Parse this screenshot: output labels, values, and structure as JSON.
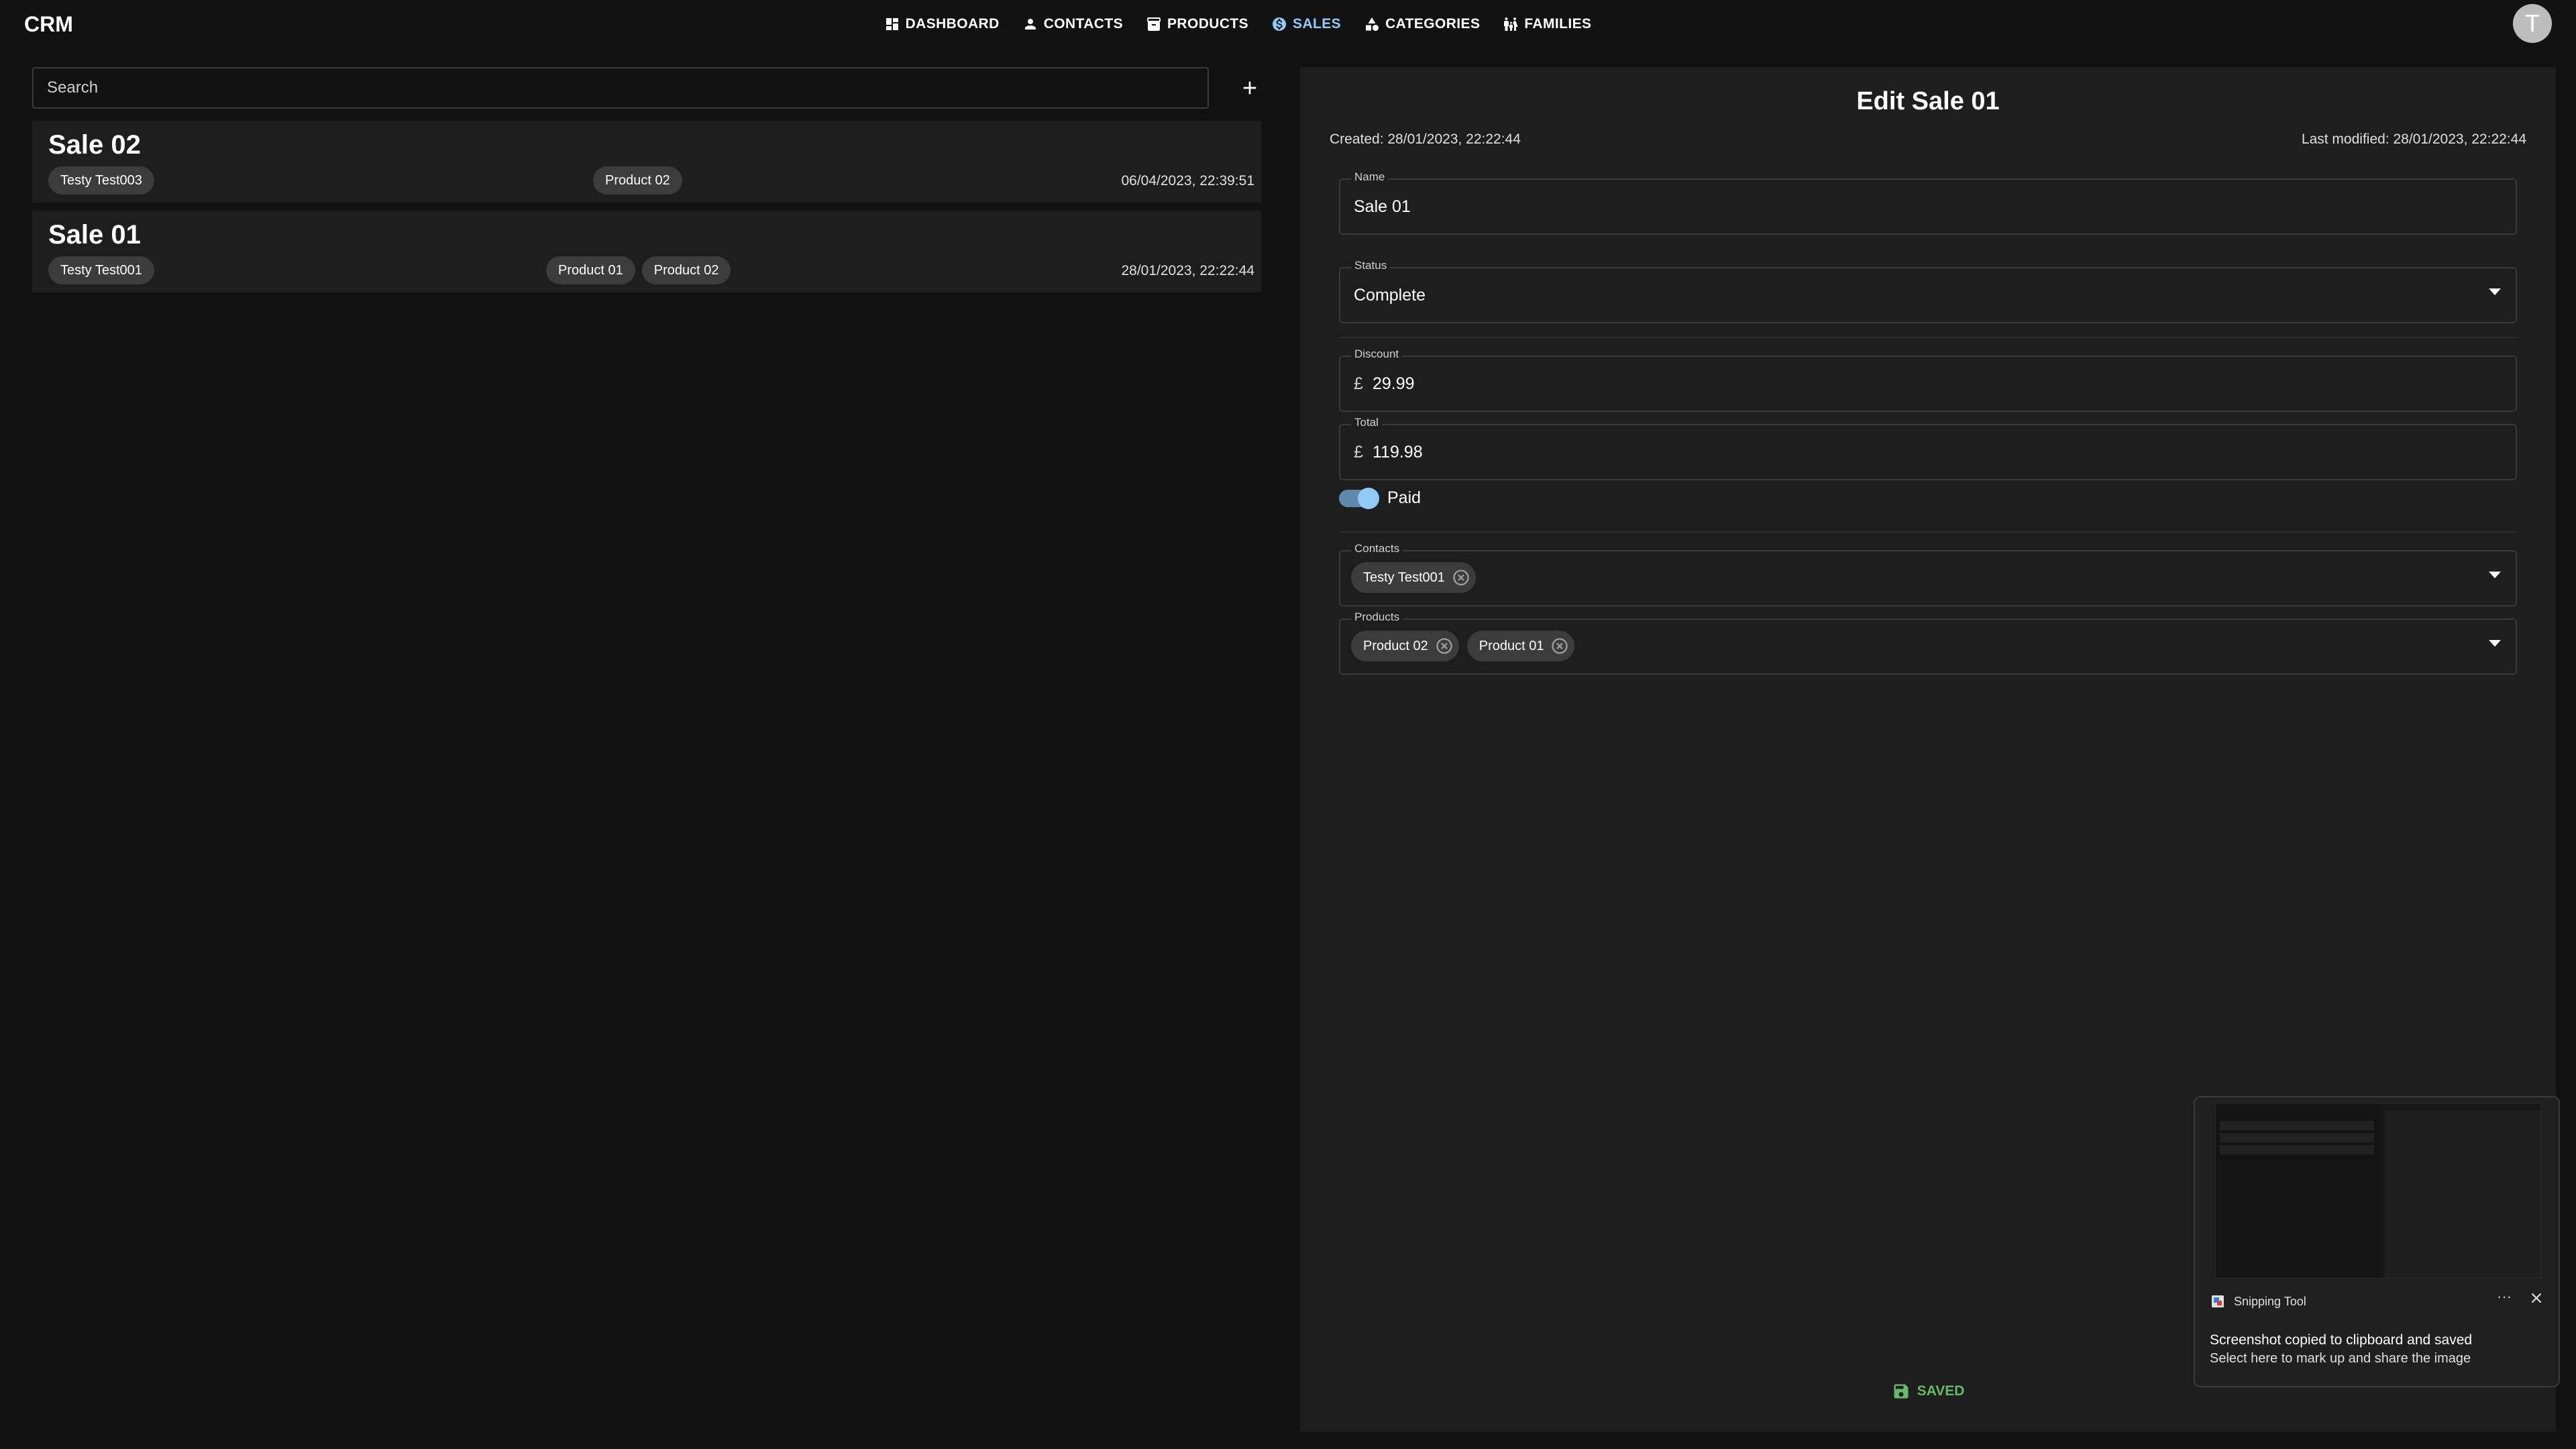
{
  "app": {
    "title": "CRM",
    "avatar_letter": "T"
  },
  "nav": [
    {
      "label": "DASHBOARD",
      "icon": "dashboard-icon",
      "active": false
    },
    {
      "label": "CONTACTS",
      "icon": "person-icon",
      "active": false
    },
    {
      "label": "PRODUCTS",
      "icon": "archive-icon",
      "active": false
    },
    {
      "label": "SALES",
      "icon": "dollar-circle-icon",
      "active": true
    },
    {
      "label": "CATEGORIES",
      "icon": "shapes-icon",
      "active": false
    },
    {
      "label": "FAMILIES",
      "icon": "family-icon",
      "active": false
    }
  ],
  "search": {
    "placeholder": "Search",
    "value": ""
  },
  "sales_list": [
    {
      "title": "Sale 02",
      "contact": "Testy Test003",
      "products": [
        "Product 02"
      ],
      "date": "06/04/2023, 22:39:51"
    },
    {
      "title": "Sale 01",
      "contact": "Testy Test001",
      "products": [
        "Product 01",
        "Product 02"
      ],
      "date": "28/01/2023, 22:22:44"
    }
  ],
  "edit": {
    "title": "Edit Sale 01",
    "created": "Created: 28/01/2023, 22:22:44",
    "modified": "Last modified: 28/01/2023, 22:22:44",
    "name": {
      "label": "Name",
      "value": "Sale 01"
    },
    "status": {
      "label": "Status",
      "value": "Complete"
    },
    "discount": {
      "label": "Discount",
      "prefix": "£",
      "value": "29.99"
    },
    "total": {
      "label": "Total",
      "prefix": "£",
      "value": "119.98"
    },
    "paid": {
      "label": "Paid",
      "checked": true
    },
    "contacts": {
      "label": "Contacts",
      "chips": [
        "Testy Test001"
      ]
    },
    "products": {
      "label": "Products",
      "chips": [
        "Product 02",
        "Product 01"
      ]
    },
    "saved_label": "SAVED"
  },
  "toast": {
    "app_name": "Snipping Tool",
    "more": "···",
    "title": "Screenshot copied to clipboard and saved",
    "subtitle": "Select here to mark up and share the image"
  },
  "colors": {
    "accent": "#90caf9",
    "saved": "#66bb6a",
    "background": "#121212",
    "panel": "#1e1e1e",
    "chip": "#3c3c3c"
  }
}
